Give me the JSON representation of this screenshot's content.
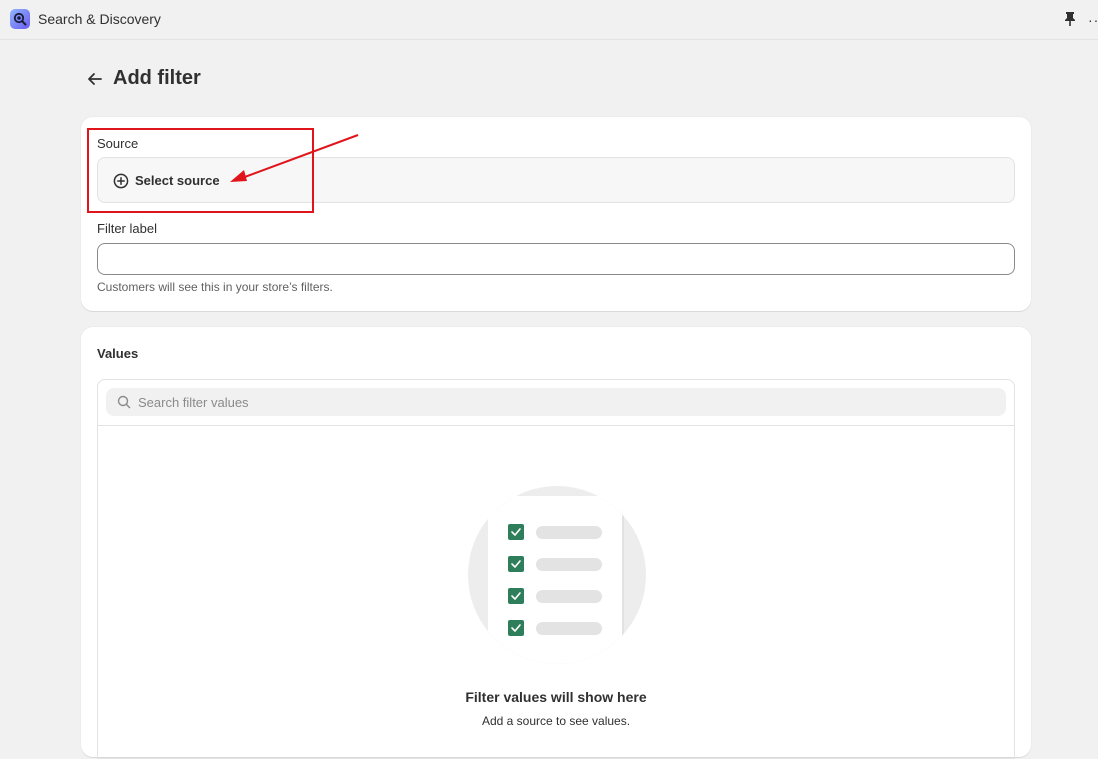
{
  "app": {
    "title": "Search & Discovery"
  },
  "page": {
    "title": "Add filter"
  },
  "source": {
    "label": "Source",
    "select_label": "Select source"
  },
  "filter_label": {
    "label": "Filter label",
    "value": "",
    "help": "Customers will see this in your store’s filters."
  },
  "values": {
    "title": "Values",
    "search_placeholder": "Search filter values",
    "empty_title": "Filter values will show here",
    "empty_subtitle": "Add a source to see values."
  },
  "icons": {
    "app": "search-discovery-app-icon",
    "pin": "pin-icon",
    "more": "more-horizontal-icon",
    "back": "arrow-left-icon",
    "plus": "plus-circle-icon",
    "search": "search-icon"
  },
  "colors": {
    "annotation": "#e0151c",
    "checkbox": "#2e7d5b",
    "background": "#f1f1f1"
  }
}
